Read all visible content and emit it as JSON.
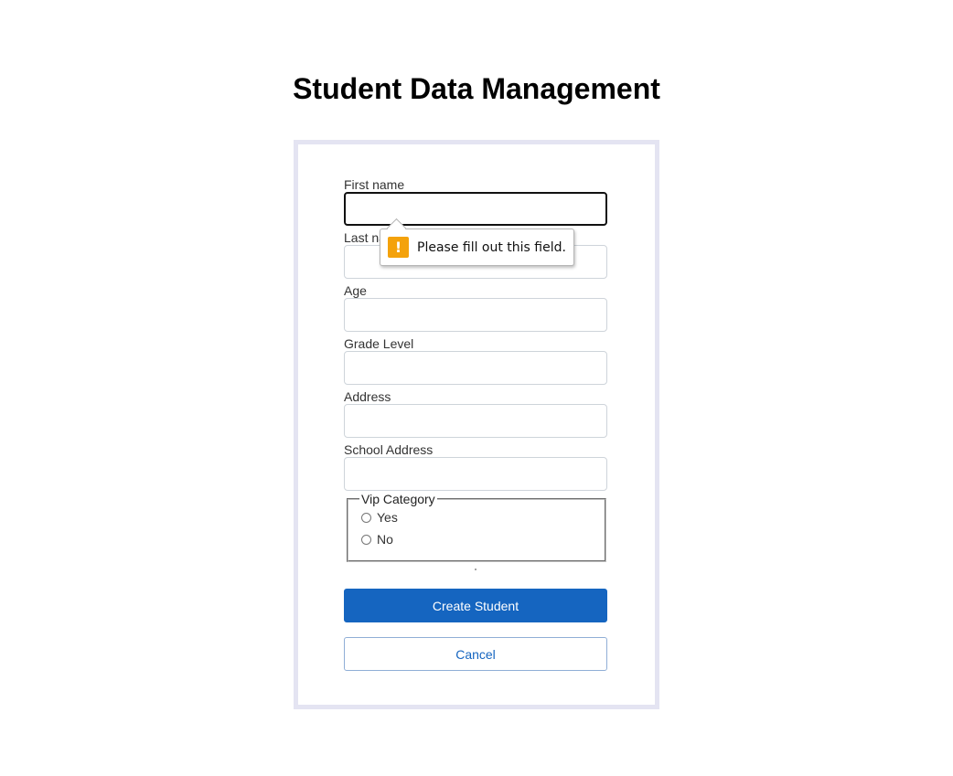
{
  "page": {
    "title": "Student Data Management"
  },
  "form": {
    "fields": [
      {
        "label": "First name",
        "value": "",
        "placeholder": ""
      },
      {
        "label": "Last name",
        "value": "",
        "placeholder": ""
      },
      {
        "label": "Age",
        "value": "",
        "placeholder": ""
      },
      {
        "label": "Grade Level",
        "value": "",
        "placeholder": ""
      },
      {
        "label": "Address",
        "value": "",
        "placeholder": ""
      },
      {
        "label": "School Address",
        "value": "",
        "placeholder": ""
      }
    ],
    "vip": {
      "legend": "Vip Category",
      "options": [
        {
          "label": "Yes",
          "checked": false
        },
        {
          "label": "No",
          "checked": false
        }
      ]
    },
    "create_button_label": "Create Student",
    "cancel_button_label": "Cancel"
  },
  "validation_tooltip": {
    "icon": "warning-icon",
    "icon_glyph": "!",
    "message": "Please fill out this field."
  },
  "colors": {
    "primary": "#1565c0",
    "card_border": "#e4e4f2",
    "warning": "#f4a20b"
  }
}
